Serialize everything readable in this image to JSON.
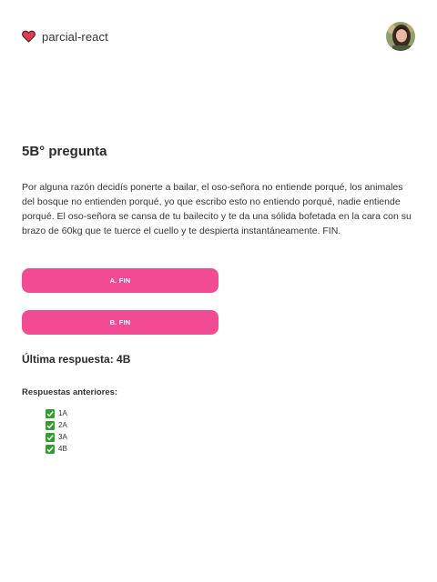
{
  "header": {
    "brand_name": "parcial-react",
    "brand_icon": "heart-icon",
    "avatar_icon": "user-avatar"
  },
  "question": {
    "title": "5B° pregunta",
    "text": "Por alguna razón decidís ponerte a bailar, el oso-señora no entiende porqué, los animales del bosque no entienden porqué, yo que escribo esto no entiendo porqué, nadie entiende porqué. El oso-señora se cansa de tu bailecito y te da una sólida bofetada en la cara con su brazo de 60kg que te tuerce el cuello y te despierta instantáneamente. FIN."
  },
  "answers": [
    {
      "label": "A. FIN"
    },
    {
      "label": "B. FIN"
    }
  ],
  "last_answer": "Última respuesta: 4B",
  "previous": {
    "title": "Respuestas anteriores:",
    "items": [
      "1A",
      "2A",
      "3A",
      "4B"
    ]
  },
  "colors": {
    "accent": "#f24a93",
    "check": "#2e9e2e"
  }
}
